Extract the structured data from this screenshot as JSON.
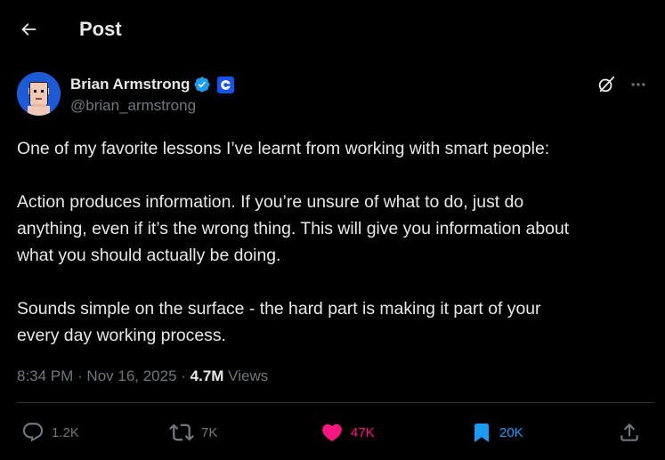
{
  "header": {
    "title": "Post",
    "back_icon": "arrow-left-icon"
  },
  "author": {
    "name": "Brian Armstrong",
    "handle": "@brian_armstrong",
    "verified_icon": "verified-badge-icon",
    "affiliate_icon": "coinbase-logo-icon"
  },
  "post": {
    "paragraphs": [
      "One of my favorite lessons I’ve learnt from working with smart people:",
      "Action produces information. If you’re unsure of what to do, just do\nanything, even if it’s the wrong thing. This will give you information about\nwhat you should actually be doing.",
      "Sounds simple on the surface - the hard part is making it part of your\nevery day working process."
    ],
    "time": "8:34 PM · Nov 16, 2025",
    "separator": " · ",
    "views_count": "4.7M",
    "views_label": " Views"
  },
  "actions": {
    "replies": "1.2K",
    "reposts": "7K",
    "likes": "47K",
    "bookmarks": "20K",
    "liked": true,
    "bookmarked": true
  },
  "colors": {
    "background": "#000000",
    "text": "#e7e9ea",
    "secondary": "#71767b",
    "accent_blue": "#1d9bf0",
    "like_pink": "#f91880",
    "coinbase_blue": "#1652f0",
    "avatar_bg": "#1d5bd6"
  }
}
